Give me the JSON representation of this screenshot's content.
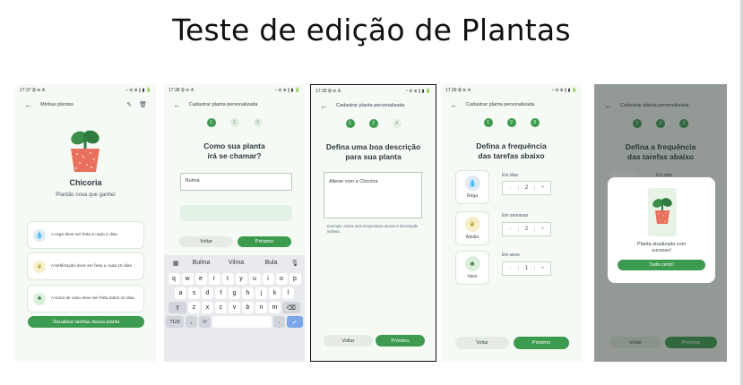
{
  "slide": {
    "title": "Teste de edição de Plantas"
  },
  "colors": {
    "accent": "#3d9b50",
    "background": "#f6faf5",
    "water": "#4a8fc2",
    "fertilizer": "#b59b2b",
    "pot": "#3d7d4a"
  },
  "screens": [
    {
      "status": {
        "time": "17:37",
        "icons": "⚙ ✉ ᗑ",
        "right": "◔ ⊘ ⧖ ∥ ▮ 🔋"
      },
      "appbar": {
        "title": "Minhas plantas",
        "edit_icon": "edit-icon",
        "delete_icon": "trash-icon"
      },
      "plant": {
        "name": "Chicoria",
        "description": "Plantão nova que ganhei"
      },
      "tasks": [
        {
          "icon": "water-drop-icon",
          "text": "A rega deve ser feita a cada 2 dias"
        },
        {
          "icon": "leaf-icon",
          "text": "A fertilização deve ser feita a cada 15 dias"
        },
        {
          "icon": "plant-pot-icon",
          "text": "A troca de vaso deve ser feita todos os dias"
        }
      ],
      "button": "Visualizar tarefas dessa planta"
    },
    {
      "status": {
        "time": "17:38",
        "icons": "⚙ ✉ ᗑ",
        "right": "◔ ⊘ ⧖ ∥ ▮ 🔋"
      },
      "appbar": {
        "title": "Cadastrar planta personalizada"
      },
      "steps": [
        "1",
        "2",
        "3"
      ],
      "heading_line1": "Como sua planta",
      "heading_line2": "irá se chamar?",
      "name_value": "Bulma",
      "back": "Voltar",
      "next": "Próximo",
      "keyboard": {
        "suggestions": [
          "Bulma",
          "Vilma",
          "Bula"
        ],
        "row1": [
          "q",
          "w",
          "e",
          "r",
          "t",
          "y",
          "u",
          "i",
          "o",
          "p"
        ],
        "row1_super": [
          "1",
          "2",
          "3",
          "4",
          "5",
          "6",
          "7",
          "8",
          "9",
          "0"
        ],
        "row2": [
          "a",
          "s",
          "d",
          "f",
          "g",
          "h",
          "j",
          "k",
          "l"
        ],
        "row3": [
          "z",
          "x",
          "c",
          "v",
          "b",
          "n",
          "m"
        ],
        "symbols": "?123",
        "comma": ",",
        "period": "."
      }
    },
    {
      "status": {
        "time": "17:39",
        "icons": "⚙ ✉ ᗑ",
        "right": "◔ ⊘ ⧖ ∥ ▮ 🔋"
      },
      "appbar": {
        "title": "Cadastrar planta personalizada"
      },
      "steps": [
        "1",
        "2",
        "3"
      ],
      "heading_line1": "Defina uma boa descrição",
      "heading_line2": "para sua planta",
      "description_value": "Alterar com a Chicória",
      "hint": "Exemplo: Adora uma temperatura amena e iluminação indireta.",
      "back": "Voltar",
      "next": "Próximo"
    },
    {
      "status": {
        "time": "17:39",
        "icons": "⚙ ✉ ᗑ",
        "right": "◔ ⊘ ⧖ ∥ ▮ 🔋"
      },
      "appbar": {
        "title": "Cadastrar planta personalizada"
      },
      "steps": [
        "1",
        "2",
        "3"
      ],
      "heading_line1": "Defina a frequência",
      "heading_line2": "das tarefas abaixo",
      "frequencies": [
        {
          "icon": "water-drop-icon",
          "label": "Rega",
          "unit": "Em dias",
          "value": "2"
        },
        {
          "icon": "leaf-icon",
          "label": "Adubo",
          "unit": "Em semanas",
          "value": "2"
        },
        {
          "icon": "plant-pot-icon",
          "label": "Vaso",
          "unit": "Em anos",
          "value": "1"
        }
      ],
      "minus": "-",
      "plus": "+",
      "back": "Voltar",
      "next": "Próximo"
    },
    {
      "appbar": {
        "title": "Cadastrar planta personalizada"
      },
      "steps": [
        "1",
        "2",
        "3"
      ],
      "heading_line1": "Defina a frequência",
      "heading_line2": "das tarefas abaixo",
      "behind_unit": "Em dias",
      "modal": {
        "message_line1": "Planta atualizada com",
        "message_line2": "sucesso!",
        "button": "Tudo certo!"
      },
      "back": "Voltar",
      "next": "Próximo"
    }
  ]
}
